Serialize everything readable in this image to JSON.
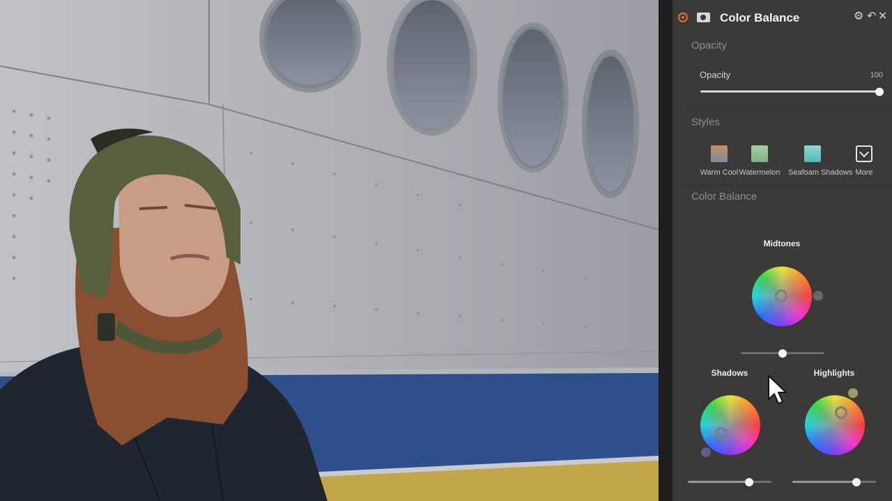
{
  "panel": {
    "title": "Color Balance",
    "header_icons": {
      "settings": "gear-icon",
      "reset": "undo-icon",
      "close": "close-icon"
    },
    "opacity_section": {
      "title": "Opacity",
      "slider_label": "Opacity",
      "slider_value": "100",
      "slider_fraction": 1.0
    },
    "styles_section": {
      "title": "Styles",
      "items": [
        {
          "label": "Warm Cool",
          "swatch_top": "#c98f63",
          "swatch_bottom": "#7d8aa0"
        },
        {
          "label": "Watermelon",
          "swatch_top": "#a8cfa0",
          "swatch_bottom": "#7db08a"
        },
        {
          "label": "Seafoam Shadows",
          "swatch_top": "#8fd8cf",
          "swatch_bottom": "#4fbdb5"
        }
      ],
      "more_label": "More"
    },
    "color_balance_section": {
      "title": "Color Balance",
      "midtones": {
        "label": "Midtones",
        "slider_fraction": 0.5
      },
      "shadows": {
        "label": "Shadows",
        "slider_fraction": 0.73,
        "dot_color": "#5b5f8a"
      },
      "highlights": {
        "label": "Highlights",
        "slider_fraction": 0.77,
        "dot_color": "#9b9a6a"
      }
    }
  },
  "accent_color": "#e0742c"
}
